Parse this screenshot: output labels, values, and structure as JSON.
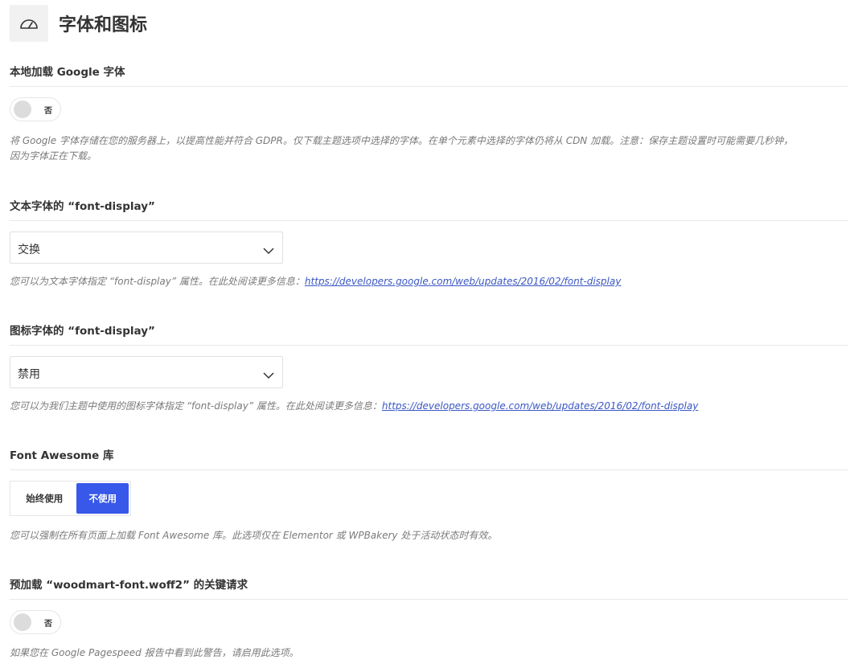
{
  "header": {
    "title": "字体和图标",
    "icon": "speedometer-icon"
  },
  "local_google_fonts": {
    "title": "本地加载 Google 字体",
    "toggle_label": "否",
    "description_line1": "将 Google 字体存储在您的服务器上，以提高性能并符合 GDPR。仅下载主题选项中选择的字体。在单个元素中选择的字体仍将从 CDN 加载。注意：保存主题设置时可能需要几秒钟，",
    "description_line2": "因为字体正在下载。"
  },
  "text_font_display": {
    "title": "文本字体的 “font-display”",
    "selected": "交换",
    "description": "您可以为文本字体指定 “font-display” 属性。在此处阅读更多信息：",
    "link": "https://developers.google.com/web/updates/2016/02/font-display"
  },
  "icon_font_display": {
    "title": "图标字体的 “font-display”",
    "selected": "禁用",
    "description": "您可以为我们主题中使用的图标字体指定 “font-display” 属性。在此处阅读更多信息：",
    "link": "https://developers.google.com/web/updates/2016/02/font-display"
  },
  "font_awesome": {
    "title": "Font Awesome 库",
    "option_always": "始终使用",
    "option_never": "不使用",
    "description": "您可以强制在所有页面上加载 Font Awesome 库。此选项仅在 Elementor 或 WPBakery 处于活动状态时有效。"
  },
  "preload_font": {
    "title": "预加载 “woodmart-font.woff2” 的关键请求",
    "toggle_label": "否",
    "description": "如果您在 Google Pagespeed 报告中看到此警告，请启用此选项。"
  },
  "colors": {
    "accent": "#3858e9",
    "link": "#3a57c4"
  }
}
